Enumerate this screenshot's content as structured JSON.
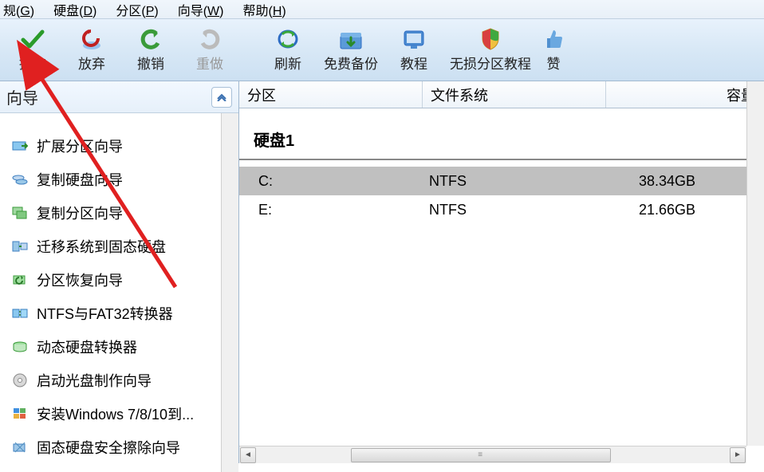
{
  "menu": {
    "items": [
      {
        "label": "规",
        "key": "G"
      },
      {
        "label": "硬盘",
        "key": "D"
      },
      {
        "label": "分区",
        "key": "P"
      },
      {
        "label": "向导",
        "key": "W"
      },
      {
        "label": "帮助",
        "key": "H"
      }
    ]
  },
  "toolbar": {
    "commit": "提交",
    "discard": "放弃",
    "undo": "撤销",
    "redo": "重做",
    "refresh": "刷新",
    "backup": "免费备份",
    "tutorial": "教程",
    "lossless": "无损分区教程",
    "like": "赞"
  },
  "left": {
    "title": "向导",
    "items": [
      {
        "label": "扩展分区向导"
      },
      {
        "label": "复制硬盘向导"
      },
      {
        "label": "复制分区向导"
      },
      {
        "label": "迁移系统到固态硬盘"
      },
      {
        "label": "分区恢复向导"
      },
      {
        "label": "NTFS与FAT32转换器"
      },
      {
        "label": "动态硬盘转换器"
      },
      {
        "label": "启动光盘制作向导"
      },
      {
        "label": "安装Windows 7/8/10到..."
      },
      {
        "label": "固态硬盘安全擦除向导"
      }
    ]
  },
  "right": {
    "columns": {
      "partition": "分区",
      "filesystem": "文件系统",
      "capacity": "容量"
    },
    "disk_title": "硬盘1",
    "rows": [
      {
        "letter": "C:",
        "fs": "NTFS",
        "cap": "38.34GB",
        "selected": true
      },
      {
        "letter": "E:",
        "fs": "NTFS",
        "cap": "21.66GB",
        "selected": false
      }
    ]
  }
}
